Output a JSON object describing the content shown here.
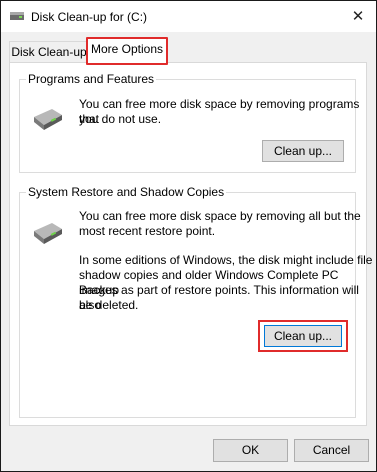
{
  "window": {
    "title": "Disk Clean-up for  (C:)",
    "close_glyph": "✕"
  },
  "tabs": [
    {
      "label": "Disk Clean-up"
    },
    {
      "label": "More Options"
    }
  ],
  "programs_group": {
    "title": "Programs and Features",
    "description_line1": "You can free more disk space by removing programs that",
    "description_line2": "you do not use.",
    "button_label": "Clean up..."
  },
  "restore_group": {
    "title": "System Restore and Shadow Copies",
    "description_line1": "You can free more disk space by removing all but the",
    "description_line2": "most recent restore point.",
    "note_line1": "In some editions of Windows, the disk might include file",
    "note_line2": "shadow copies and older Windows Complete PC Backup",
    "note_line3": "images as part of restore points. This information will also",
    "note_line4": "be deleted.",
    "button_label": "Clean up..."
  },
  "footer": {
    "ok_label": "OK",
    "cancel_label": "Cancel"
  },
  "icons": [
    "drive-icon",
    "close-icon"
  ],
  "colors": {
    "highlight": "#e02b2b",
    "focus_border": "#0078d7"
  }
}
